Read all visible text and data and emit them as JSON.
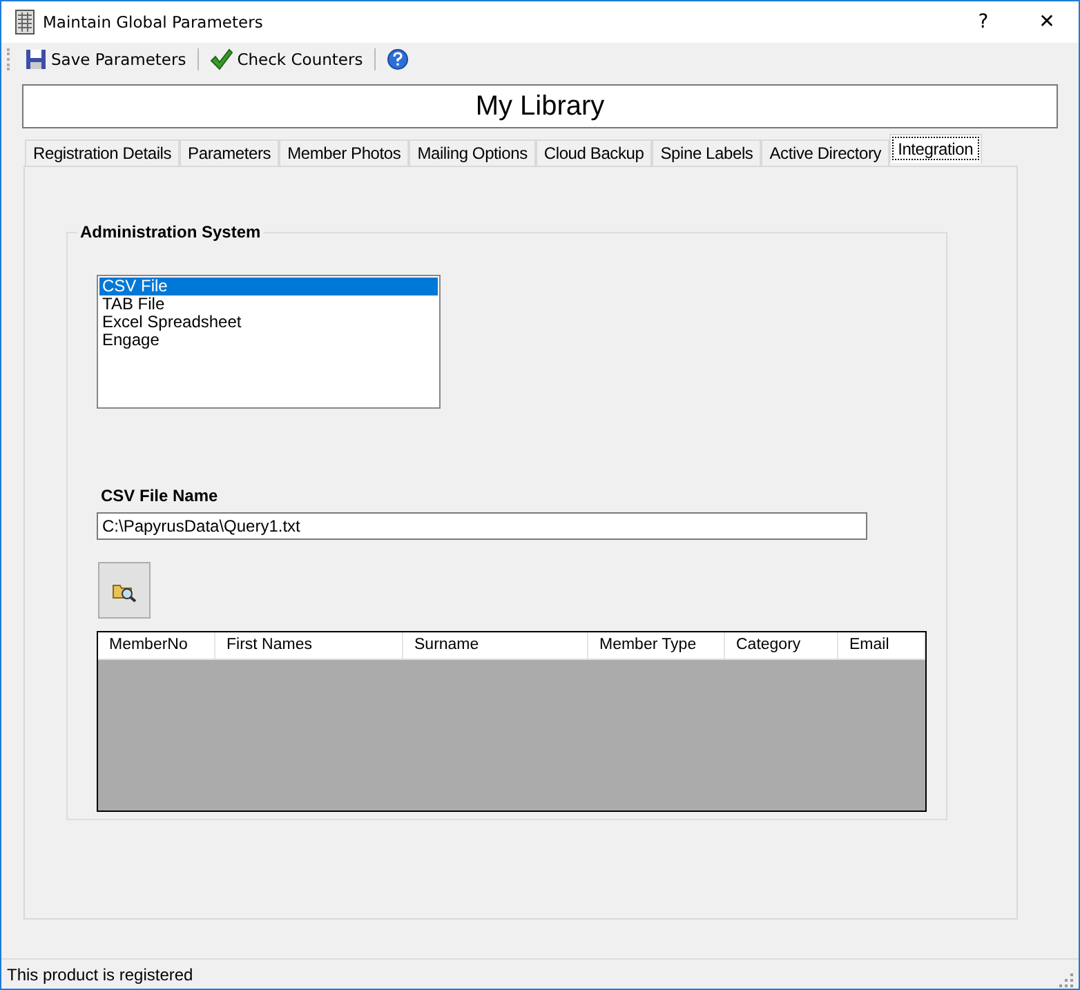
{
  "window": {
    "title": "Maintain Global Parameters",
    "help_button": "?",
    "close_button": "✕"
  },
  "toolbar": [
    {
      "kind": "save",
      "label": "Save Parameters"
    },
    {
      "kind": "check",
      "label": "Check Counters"
    },
    {
      "kind": "help"
    }
  ],
  "library_name": "My Library",
  "tabs": [
    {
      "label": "Registration Details",
      "selected": false
    },
    {
      "label": "Parameters",
      "selected": false
    },
    {
      "label": "Member Photos",
      "selected": false
    },
    {
      "label": "Mailing Options",
      "selected": false
    },
    {
      "label": "Cloud Backup",
      "selected": false
    },
    {
      "label": "Spine Labels",
      "selected": false
    },
    {
      "label": "Active Directory",
      "selected": false
    },
    {
      "label": "Integration",
      "selected": true
    }
  ],
  "group": {
    "title": "Administration System",
    "systems": [
      {
        "label": "CSV File",
        "selected": true
      },
      {
        "label": "TAB File",
        "selected": false
      },
      {
        "label": "Excel Spreadsheet",
        "selected": false
      },
      {
        "label": "Engage",
        "selected": false
      }
    ],
    "file_name_label": "CSV File Name",
    "file_name": "C:\\PapyrusData\\Query1.txt",
    "table": {
      "columns": [
        "MemberNo",
        "First Names",
        "Surname",
        "Member Type",
        "Category",
        "Email"
      ]
    }
  },
  "status_bar": "This product is registered"
}
